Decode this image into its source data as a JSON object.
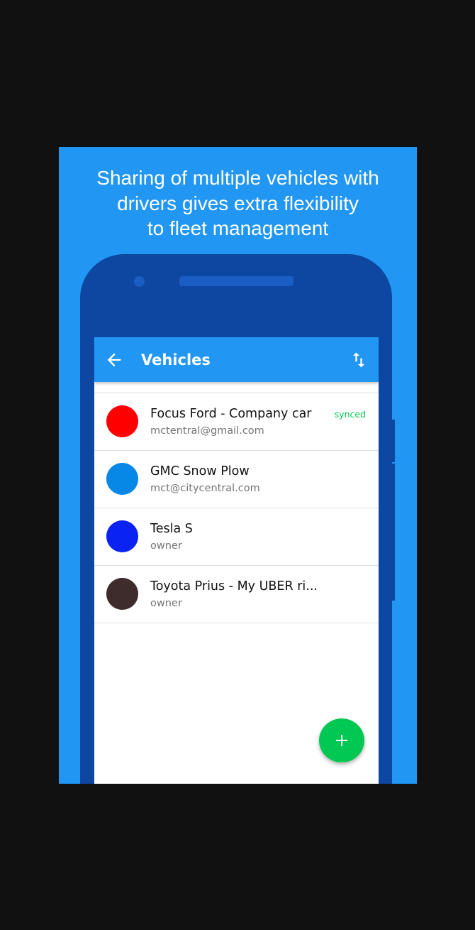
{
  "promo": {
    "headline": "Sharing of multiple vehicles with\ndrivers gives extra flexibility\nto fleet management",
    "background_color": "#2196f3"
  },
  "app": {
    "title": "Vehicles",
    "appbar_color": "#2196f3",
    "back_icon": "arrow-left-icon",
    "sort_icon": "sort-arrows-icon"
  },
  "vehicles": [
    {
      "name": "Focus Ford - Company car",
      "subtitle": "mctentral@gmail.com",
      "color": "#ff0000",
      "badge": "synced",
      "badge_color": "#00c853"
    },
    {
      "name": "GMC Snow Plow",
      "subtitle": "mct@citycentral.com",
      "color": "#0788e6"
    },
    {
      "name": "Tesla S",
      "subtitle": "owner",
      "color": "#0a23f3"
    },
    {
      "name": "Toyota Prius - My UBER ri...",
      "subtitle": "owner",
      "color": "#3e2c2c"
    }
  ],
  "fab": {
    "icon": "plus-icon",
    "color": "#00c853"
  }
}
